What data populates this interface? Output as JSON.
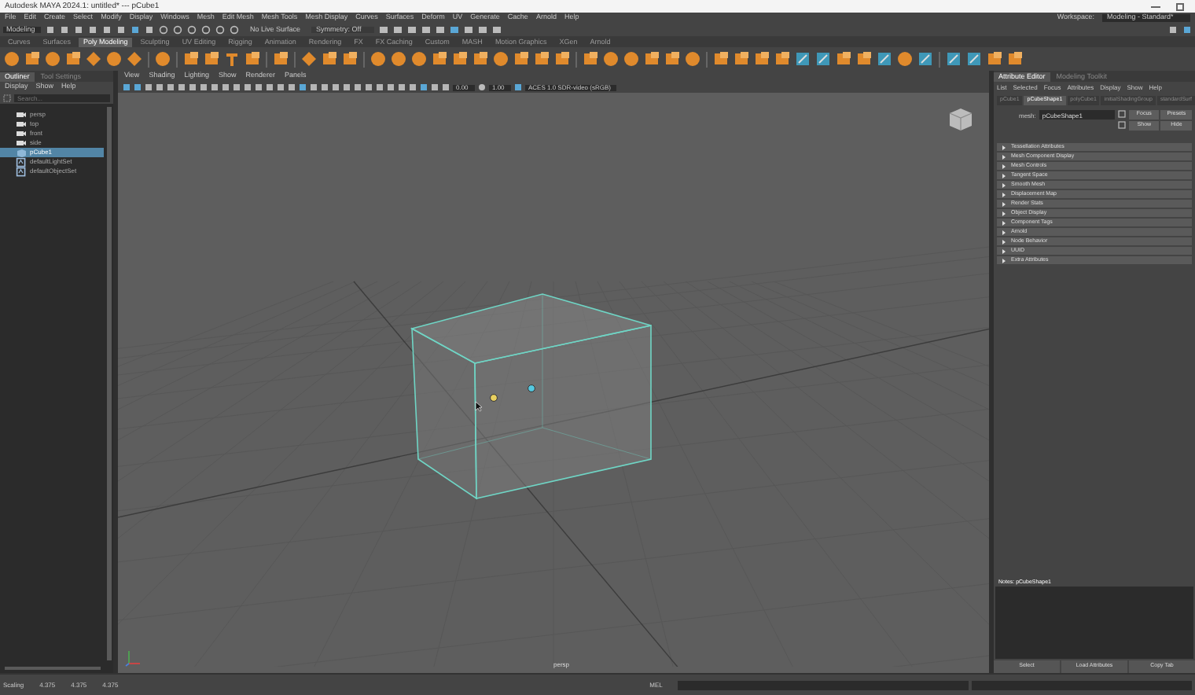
{
  "window": {
    "title": "Autodesk MAYA 2024.1: untitled* --- pCube1"
  },
  "menu_bar": [
    "File",
    "Edit",
    "Create",
    "Select",
    "Modify",
    "Display",
    "Windows",
    "Mesh",
    "Edit Mesh",
    "Mesh Tools",
    "Mesh Display",
    "Curves",
    "Surfaces",
    "Deform",
    "UV",
    "Generate",
    "Cache",
    "Arnold",
    "Help"
  ],
  "workspace": {
    "label": "Workspace:",
    "value": "Modeling - Standard*"
  },
  "status_line": {
    "mode": "Modeling",
    "live_surface": "No Live Surface",
    "symmetry": "Symmetry: Off"
  },
  "shelf_tabs": [
    {
      "label": "Curves",
      "selected": false
    },
    {
      "label": "Surfaces",
      "selected": false
    },
    {
      "label": "Poly Modeling",
      "selected": true
    },
    {
      "label": "Sculpting",
      "selected": false
    },
    {
      "label": "UV Editing",
      "selected": false
    },
    {
      "label": "Rigging",
      "selected": false
    },
    {
      "label": "Animation",
      "selected": false
    },
    {
      "label": "Rendering",
      "selected": false
    },
    {
      "label": "FX",
      "selected": false
    },
    {
      "label": "FX Caching",
      "selected": false
    },
    {
      "label": "Custom",
      "selected": false
    },
    {
      "label": "MASH",
      "selected": false
    },
    {
      "label": "Motion Graphics",
      "selected": false
    },
    {
      "label": "XGen",
      "selected": false
    },
    {
      "label": "Arnold",
      "selected": false
    }
  ],
  "outliner": {
    "tabs": [
      {
        "label": "Outliner",
        "selected": true
      },
      {
        "label": "Tool Settings",
        "selected": false
      }
    ],
    "menu": [
      "Display",
      "Show",
      "Help"
    ],
    "search": {
      "placeholder": "Search..."
    },
    "items": [
      {
        "label": "persp",
        "kind": "camera",
        "selected": false
      },
      {
        "label": "top",
        "kind": "camera",
        "selected": false
      },
      {
        "label": "front",
        "kind": "camera",
        "selected": false
      },
      {
        "label": "side",
        "kind": "camera",
        "selected": false
      },
      {
        "label": "pCube1",
        "kind": "mesh",
        "selected": true
      },
      {
        "label": "defaultLightSet",
        "kind": "set",
        "selected": false
      },
      {
        "label": "defaultObjectSet",
        "kind": "set",
        "selected": false
      }
    ]
  },
  "viewport": {
    "menu": [
      "View",
      "Shading",
      "Lighting",
      "Show",
      "Renderer",
      "Panels"
    ],
    "near_value": "0.00",
    "far_value": "1.00",
    "color_space": "ACES 1.0 SDR-video (sRGB)",
    "camera_label": "persp"
  },
  "attribute_editor": {
    "tabs": [
      {
        "label": "Attribute Editor",
        "selected": true
      },
      {
        "label": "Modeling Toolkit",
        "selected": false
      }
    ],
    "menu": [
      "List",
      "Selected",
      "Focus",
      "Attributes",
      "Display",
      "Show",
      "Help"
    ],
    "node_tabs": [
      {
        "label": "pCube1",
        "selected": false
      },
      {
        "label": "pCubeShape1",
        "selected": true
      },
      {
        "label": "polyCube1",
        "selected": false
      },
      {
        "label": "initialShadingGroup",
        "selected": false
      },
      {
        "label": "standardSurf",
        "selected": false
      }
    ],
    "field": {
      "label": "mesh:",
      "value": "pCubeShape1"
    },
    "buttons": [
      "Focus",
      "Presets",
      "Show",
      "Hide"
    ],
    "sections": [
      "Tessellation Attributes",
      "Mesh Component Display",
      "Mesh Controls",
      "Tangent Space",
      "Smooth Mesh",
      "Displacement Map",
      "Render Stats",
      "Object Display",
      "Component Tags",
      "Arnold",
      "Node Behavior",
      "UUID",
      "Extra Attributes"
    ],
    "notes_label": "Notes: pCubeShape1",
    "footer_buttons": [
      "Select",
      "Load Attributes",
      "Copy Tab"
    ]
  },
  "help_line": {
    "label": "Scaling",
    "values": [
      "4.375",
      "4.375",
      "4.375"
    ]
  },
  "command_line": {
    "label": "MEL"
  }
}
